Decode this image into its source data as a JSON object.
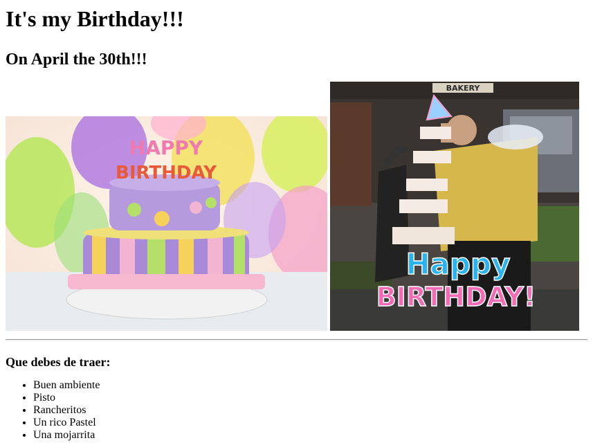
{
  "page": {
    "title": "It's my Birthday!!!",
    "subtitle": "On April the 30th!!!",
    "section_heading": "Que debes de traer:",
    "items": [
      "Buen ambiente",
      "Pisto",
      "Rancheritos",
      "Un rico Pastel",
      "Una mojarrita"
    ]
  },
  "images": {
    "cake_photo": {
      "candle_letters_top": "HAPPY",
      "candle_letters_bottom": "BIRTHDAY"
    },
    "gif": {
      "sign_text": "BAKERY",
      "caption_top": "Happy",
      "caption_bottom": "BIRTHDAY!"
    }
  },
  "colors": {
    "text": "#000000",
    "divider": "#9a9a9a",
    "caption_happy": "#2bb3f0",
    "caption_birthday": "#f26bb5"
  }
}
